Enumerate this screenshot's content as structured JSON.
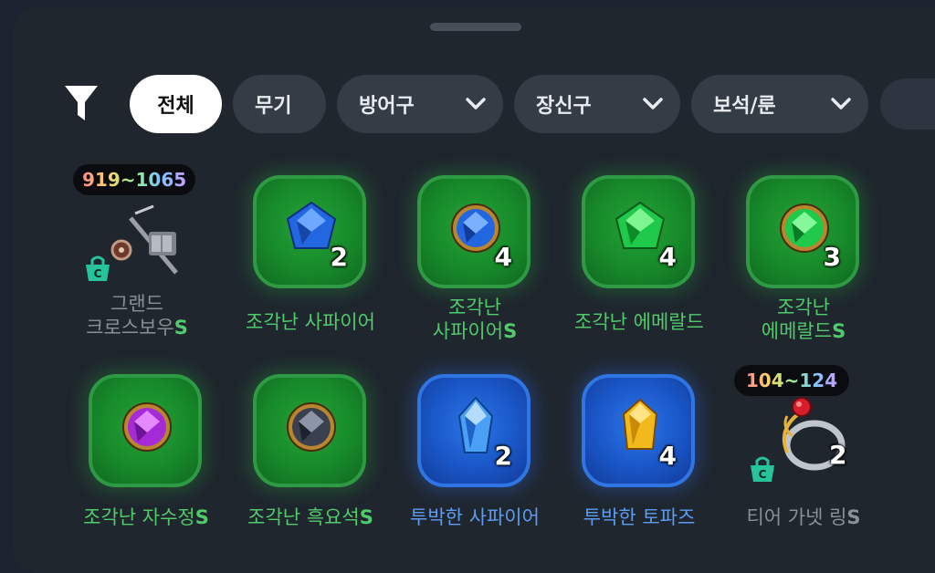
{
  "filter": {
    "icon": "filter-icon"
  },
  "tabs": [
    {
      "label": "전체",
      "active": true,
      "dropdown": false
    },
    {
      "label": "무기",
      "active": false,
      "dropdown": false
    },
    {
      "label": "방어구",
      "active": false,
      "dropdown": true
    },
    {
      "label": "장신구",
      "active": false,
      "dropdown": true
    },
    {
      "label": "보석/룬",
      "active": false,
      "dropdown": true
    }
  ],
  "items": [
    {
      "name": "그랜드 크로스보우",
      "line1": "그랜드",
      "line2": "크로스보우",
      "grade": "S",
      "range": "919~1065",
      "icon": "crossbow-icon",
      "count": "",
      "rarity": "gray"
    },
    {
      "name": "조각난 사파이어",
      "line1": "조각난 사파이어",
      "line2": "",
      "grade": "",
      "count": "2",
      "icon": "sapphire-icon",
      "rarity": "green"
    },
    {
      "name": "조각난 사파이어",
      "line1": "조각난",
      "line2": "사파이어",
      "grade": "S",
      "count": "4",
      "icon": "sapphire-icon",
      "rarity": "green"
    },
    {
      "name": "조각난 에메랄드",
      "line1": "조각난 에메랄드",
      "line2": "",
      "grade": "",
      "count": "4",
      "icon": "emerald-icon",
      "rarity": "green"
    },
    {
      "name": "조각난 에메랄드",
      "line1": "조각난",
      "line2": "에메랄드",
      "grade": "S",
      "count": "3",
      "icon": "emerald-icon",
      "rarity": "green"
    },
    {
      "name": "조각난 자수정",
      "line1": "조각난 자수정",
      "line2": "",
      "grade": "S",
      "count": "",
      "icon": "amethyst-icon",
      "rarity": "green"
    },
    {
      "name": "조각난 흑요석",
      "line1": "조각난 흑요석",
      "line2": "",
      "grade": "S",
      "count": "",
      "icon": "obsidian-icon",
      "rarity": "green"
    },
    {
      "name": "투박한 사파이어",
      "line1": "투박한 사파이어",
      "line2": "",
      "grade": "",
      "count": "2",
      "icon": "rough-sapphire-icon",
      "rarity": "blue"
    },
    {
      "name": "투박한 토파즈",
      "line1": "투박한 토파즈",
      "line2": "",
      "grade": "",
      "count": "4",
      "icon": "topaz-icon",
      "rarity": "blue"
    },
    {
      "name": "티어 가넷 링",
      "line1": "티어 가넷 링",
      "line2": "",
      "grade": "S",
      "range": "104~124",
      "icon": "garnet-ring-icon",
      "count": "2",
      "rarity": "gray"
    }
  ]
}
